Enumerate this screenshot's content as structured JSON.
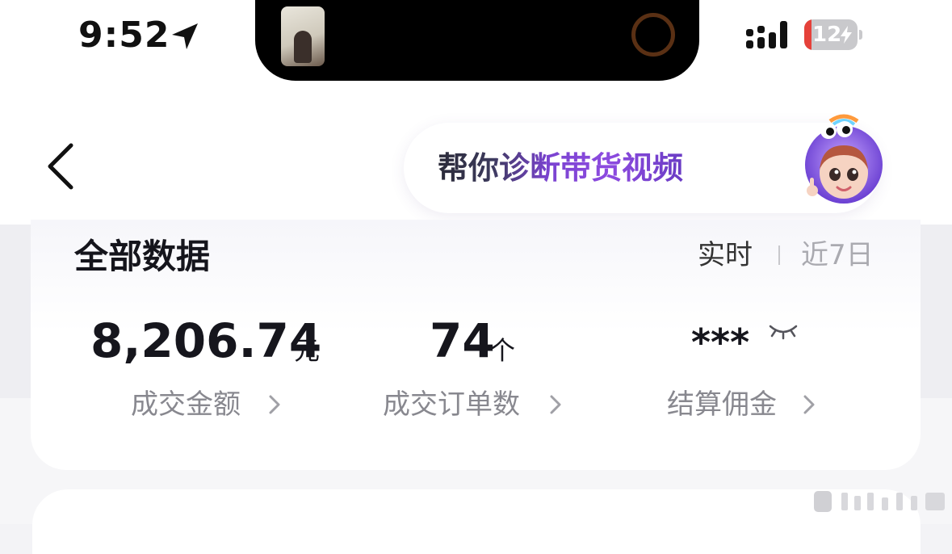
{
  "status_bar": {
    "time": "9:52",
    "battery_level": "12"
  },
  "nav": {
    "ai_prompt": "帮你诊断带货视频"
  },
  "summary": {
    "title": "全部数据",
    "range_options": [
      "实时",
      "近7日"
    ],
    "selected_range": "实时",
    "metrics": [
      {
        "value": "8,206.74",
        "unit": "元",
        "label": "成交金额"
      },
      {
        "value": "74",
        "unit": "个",
        "label": "成交订单数"
      },
      {
        "value": "***",
        "unit": "",
        "label": "结算佣金"
      }
    ]
  },
  "colors": {
    "accent_purple": "#8d4be0",
    "battery_low": "#e5413a"
  },
  "icons": [
    "location-arrow-icon",
    "signal-icon",
    "battery-icon",
    "back-chevron-icon",
    "ai-assistant-avatar",
    "eye-closed-icon",
    "chevron-right-icon"
  ]
}
